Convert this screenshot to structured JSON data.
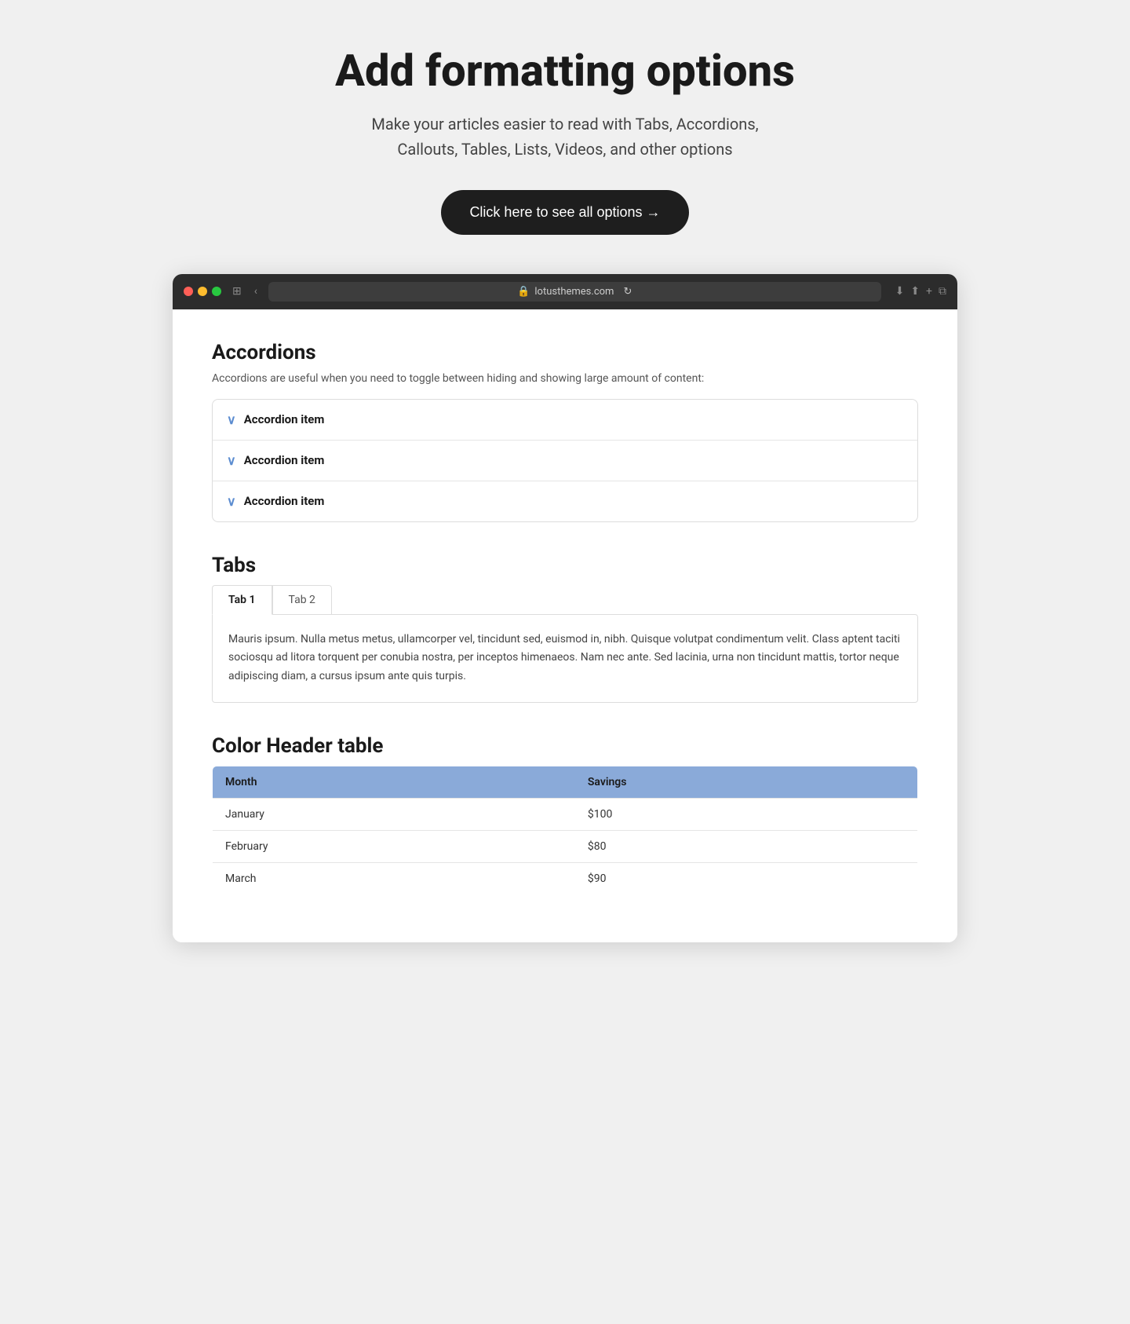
{
  "hero": {
    "title": "Add formatting options",
    "subtitle": "Make your articles easier to read with Tabs, Accordions,\nCallouts, Tables, Lists, Videos, and other options",
    "cta_label": "Click here to see all options →"
  },
  "browser": {
    "url": "lotusthemes.com",
    "dots": [
      "red",
      "yellow",
      "green"
    ]
  },
  "accordions_section": {
    "title": "Accordions",
    "description": "Accordions are useful when you need to toggle between hiding and showing large amount of content:",
    "items": [
      {
        "label": "Accordion item"
      },
      {
        "label": "Accordion item"
      },
      {
        "label": "Accordion item"
      }
    ]
  },
  "tabs_section": {
    "title": "Tabs",
    "tabs": [
      {
        "label": "Tab 1",
        "active": true
      },
      {
        "label": "Tab 2",
        "active": false
      }
    ],
    "content": "Mauris ipsum. Nulla metus metus, ullamcorper vel, tincidunt sed, euismod in, nibh. Quisque volutpat condimentum velit. Class aptent taciti sociosqu ad litora torquent per conubia nostra, per inceptos himenaeos. Nam nec ante. Sed lacinia, urna non tincidunt mattis, tortor neque adipiscing diam, a cursus ipsum ante quis turpis."
  },
  "table_section": {
    "title": "Color Header table",
    "columns": [
      "Month",
      "Savings"
    ],
    "rows": [
      [
        "January",
        "$100"
      ],
      [
        "February",
        "$80"
      ],
      [
        "March",
        "$90"
      ]
    ]
  }
}
